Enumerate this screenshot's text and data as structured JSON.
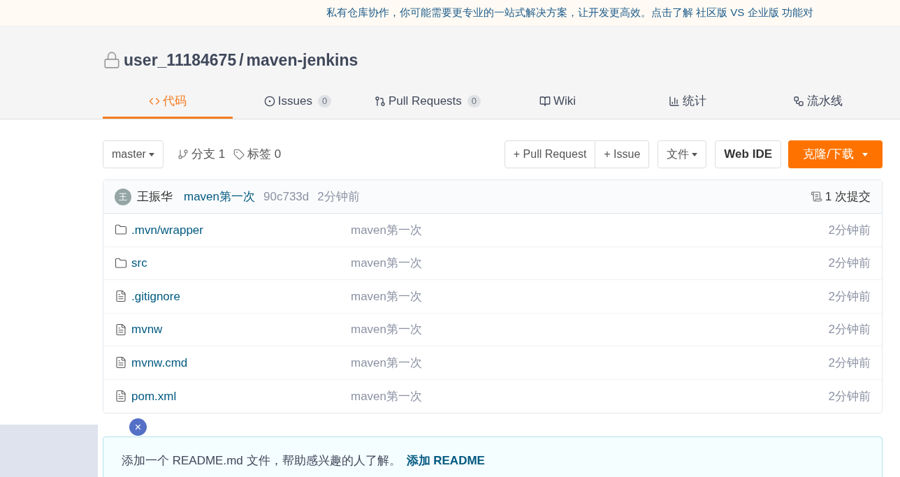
{
  "banner": {
    "text": "私有仓库协作，你可能需要更专业的一站式解决方案，让开发更高效。点击了解 社区版 VS 企业版 功能对"
  },
  "repo": {
    "owner": "user_11184675",
    "separator": "/",
    "name": "maven-jenkins"
  },
  "tabs": [
    {
      "kind": "code",
      "label": "代码",
      "selected": true
    },
    {
      "kind": "issues",
      "label": "Issues",
      "count": "0",
      "selected": false
    },
    {
      "kind": "pr",
      "label": "Pull Requests",
      "count": "0",
      "selected": false
    },
    {
      "kind": "wiki",
      "label": "Wiki",
      "selected": false
    },
    {
      "kind": "stats",
      "label": "统计",
      "selected": false
    },
    {
      "kind": "pipeline",
      "label": "流水线",
      "selected": false
    }
  ],
  "toolbar": {
    "branch": "master",
    "branches": "分支 1",
    "tags": "标签 0",
    "new_pr": "+ Pull Request",
    "new_issue": "+ Issue",
    "file_menu": "文件",
    "web_ide": "Web IDE",
    "clone": "克隆/下载"
  },
  "commit": {
    "avatar": "王",
    "author": "王振华",
    "message": "maven第一次",
    "hash": "90c733d",
    "time": "2分钟前",
    "commits": "1 次提交"
  },
  "files": [
    {
      "kind": "folder",
      "name": ".mvn/wrapper",
      "message": "maven第一次",
      "time": "2分钟前"
    },
    {
      "kind": "folder",
      "name": "src",
      "message": "maven第一次",
      "time": "2分钟前"
    },
    {
      "kind": "file",
      "name": ".gitignore",
      "message": "maven第一次",
      "time": "2分钟前"
    },
    {
      "kind": "file",
      "name": "mvnw",
      "message": "maven第一次",
      "time": "2分钟前"
    },
    {
      "kind": "file",
      "name": "mvnw.cmd",
      "message": "maven第一次",
      "time": "2分钟前"
    },
    {
      "kind": "file",
      "name": "pom.xml",
      "message": "maven第一次",
      "time": "2分钟前"
    }
  ],
  "readme": {
    "text": "添加一个 README.md 文件，帮助感兴趣的人了解。",
    "link": "添加 README"
  },
  "overlay": {
    "close": "×"
  }
}
